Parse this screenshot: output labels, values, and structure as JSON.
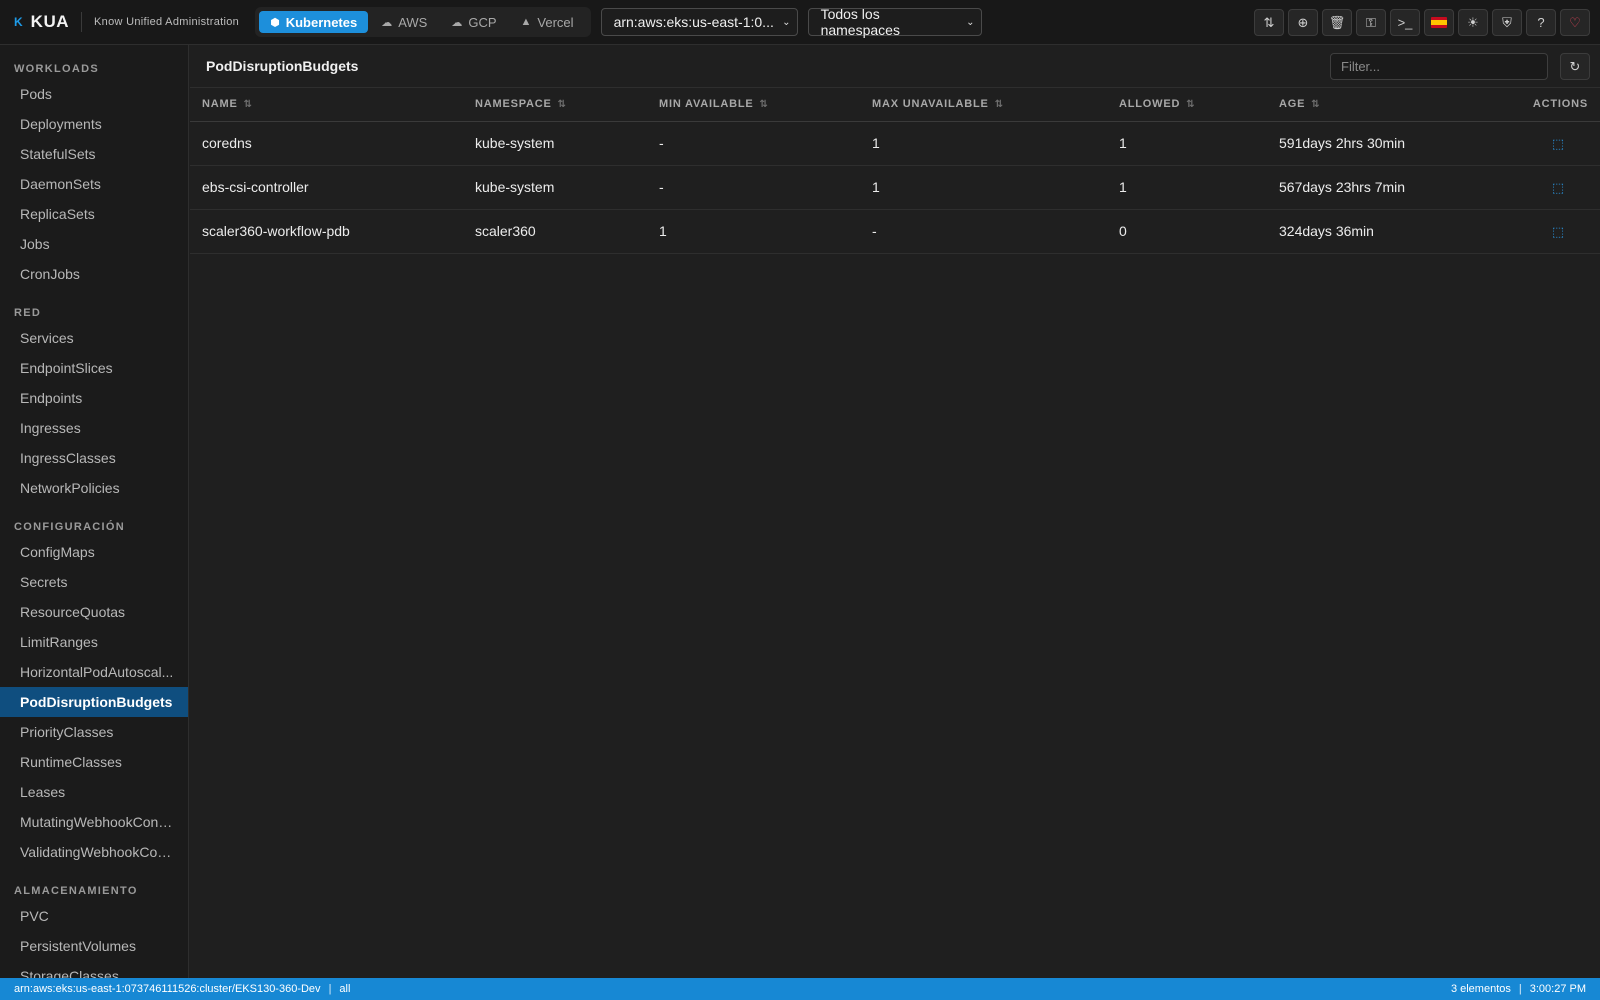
{
  "app": {
    "logo_mark": "K",
    "logo_text": "KUA",
    "subtitle": "Know Unified Administration"
  },
  "providers": [
    {
      "label": "Kubernetes",
      "icon": "cube-icon",
      "active": true
    },
    {
      "label": "AWS",
      "icon": "cloud-icon",
      "active": false
    },
    {
      "label": "GCP",
      "icon": "cloud-upload-icon",
      "active": false
    },
    {
      "label": "Vercel",
      "icon": "triangle-icon",
      "active": false
    }
  ],
  "context_select": {
    "value": "arn:aws:eks:us-east-1:0..."
  },
  "namespace_select": {
    "value": "Todos los namespaces"
  },
  "toolbar": [
    {
      "name": "port-forward",
      "icon": "arrows-updown-icon"
    },
    {
      "name": "add",
      "icon": "plus-circle-icon"
    },
    {
      "name": "delete",
      "icon": "trash-icon"
    },
    {
      "name": "key",
      "icon": "key-icon"
    },
    {
      "name": "terminal",
      "icon": "terminal-icon"
    },
    {
      "name": "language",
      "icon": "spain-flag-icon"
    },
    {
      "name": "theme",
      "icon": "sun-icon"
    },
    {
      "name": "security",
      "icon": "shield-icon"
    },
    {
      "name": "help",
      "icon": "help-icon"
    },
    {
      "name": "favorite",
      "icon": "heart-icon"
    }
  ],
  "sidebar": {
    "sections": [
      {
        "title": "WORKLOADS",
        "items": [
          "Pods",
          "Deployments",
          "StatefulSets",
          "DaemonSets",
          "ReplicaSets",
          "Jobs",
          "CronJobs"
        ]
      },
      {
        "title": "RED",
        "items": [
          "Services",
          "EndpointSlices",
          "Endpoints",
          "Ingresses",
          "IngressClasses",
          "NetworkPolicies"
        ]
      },
      {
        "title": "CONFIGURACIÓN",
        "items": [
          "ConfigMaps",
          "Secrets",
          "ResourceQuotas",
          "LimitRanges",
          "HorizontalPodAutoscal...",
          "PodDisruptionBudgets",
          "PriorityClasses",
          "RuntimeClasses",
          "Leases",
          "MutatingWebhookConfi...",
          "ValidatingWebhookCon..."
        ]
      },
      {
        "title": "ALMACENAMIENTO",
        "items": [
          "PVC",
          "PersistentVolumes",
          "StorageClasses"
        ]
      }
    ],
    "active_item": "PodDisruptionBudgets"
  },
  "main": {
    "title": "PodDisruptionBudgets",
    "filter_placeholder": "Filter...",
    "columns": [
      "NAME",
      "NAMESPACE",
      "MIN AVAILABLE",
      "MAX UNAVAILABLE",
      "ALLOWED",
      "AGE",
      "ACTIONS"
    ],
    "rows": [
      [
        "coredns",
        "kube-system",
        "-",
        "1",
        "1",
        "591days 2hrs 30min"
      ],
      [
        "ebs-csi-controller",
        "kube-system",
        "-",
        "1",
        "1",
        "567days 23hrs 7min"
      ],
      [
        "scaler360-workflow-pdb",
        "scaler360",
        "1",
        "-",
        "0",
        "324days 36min"
      ]
    ]
  },
  "statusbar": {
    "context": "arn:aws:eks:us-east-1:073746111526:cluster/EKS130-360-Dev",
    "namespace": "all",
    "count": "3 elementos",
    "time": "3:00:27 PM"
  },
  "colors": {
    "accent": "#1d8fdb",
    "active_sidebar": "#0f4e7f",
    "statusbar": "#1788d4"
  }
}
